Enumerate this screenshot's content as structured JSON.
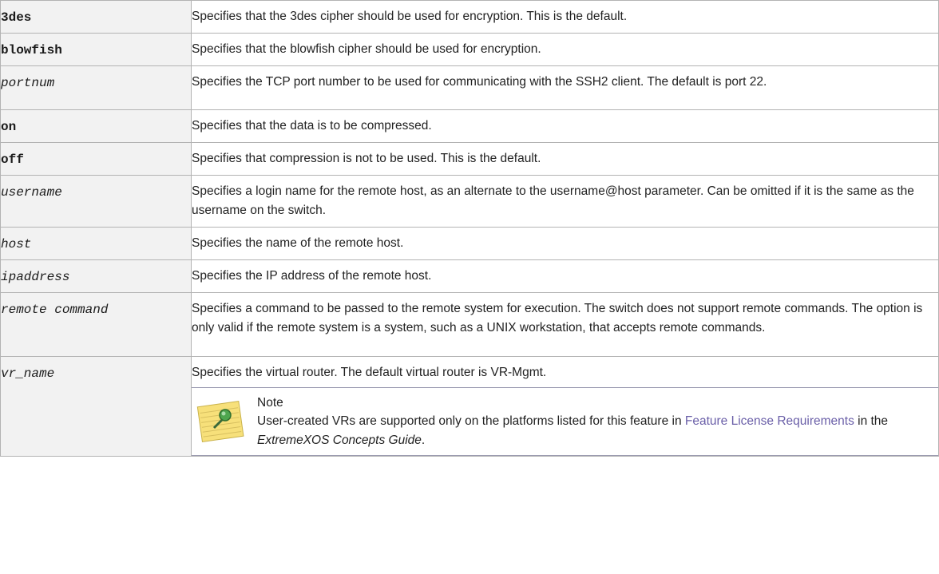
{
  "rows": [
    {
      "param": "3des",
      "style": "bold",
      "desc": "Specifies that the 3des cipher should be used for encryption. This is the default."
    },
    {
      "param": "blowfish",
      "style": "bold",
      "desc": "Specifies that the blowfish cipher should be used for encryption."
    },
    {
      "param": "portnum",
      "style": "italic",
      "desc": "Specifies the TCP port number to be used for communicating with the SSH2 client. The default is port 22."
    },
    {
      "param": "on",
      "style": "bold",
      "desc": "Specifies that the data is to be compressed."
    },
    {
      "param": "off",
      "style": "bold",
      "desc": "Specifies that compression is not to be used. This is the default."
    },
    {
      "param": "username",
      "style": "italic",
      "desc": "Specifies a login name for the remote host, as an alternate to the username@host parameter. Can be omitted if it is the same as the username on the switch."
    },
    {
      "param": "host",
      "style": "italic",
      "desc": "Specifies the name of the remote host."
    },
    {
      "param": "ipaddress",
      "style": "italic",
      "desc": "Specifies the IP address of the remote host."
    },
    {
      "param": "remote command",
      "style": "italic",
      "desc": "Specifies a command to be passed to the remote system for execution. The switch does not support remote commands. The option is only valid if the remote system is a system, such as a UNIX workstation, that accepts remote commands."
    },
    {
      "param": "vr_name",
      "style": "italic",
      "desc": "Specifies the virtual router. The default virtual router is VR-Mgmt."
    }
  ],
  "note": {
    "icon": "note-pad-icon",
    "title": "Note",
    "text_before": "User-created VRs are supported only on the platforms listed for this feature in ",
    "link": "Feature License Requirements",
    "text_middle": " in the ",
    "guide": "ExtremeXOS Concepts Guide",
    "text_after": "."
  },
  "colors": {
    "border": "#b3b3b3",
    "param_bg": "#f2f2f2",
    "link": "#6a5fa8",
    "note_rule": "#9a9ab0"
  }
}
